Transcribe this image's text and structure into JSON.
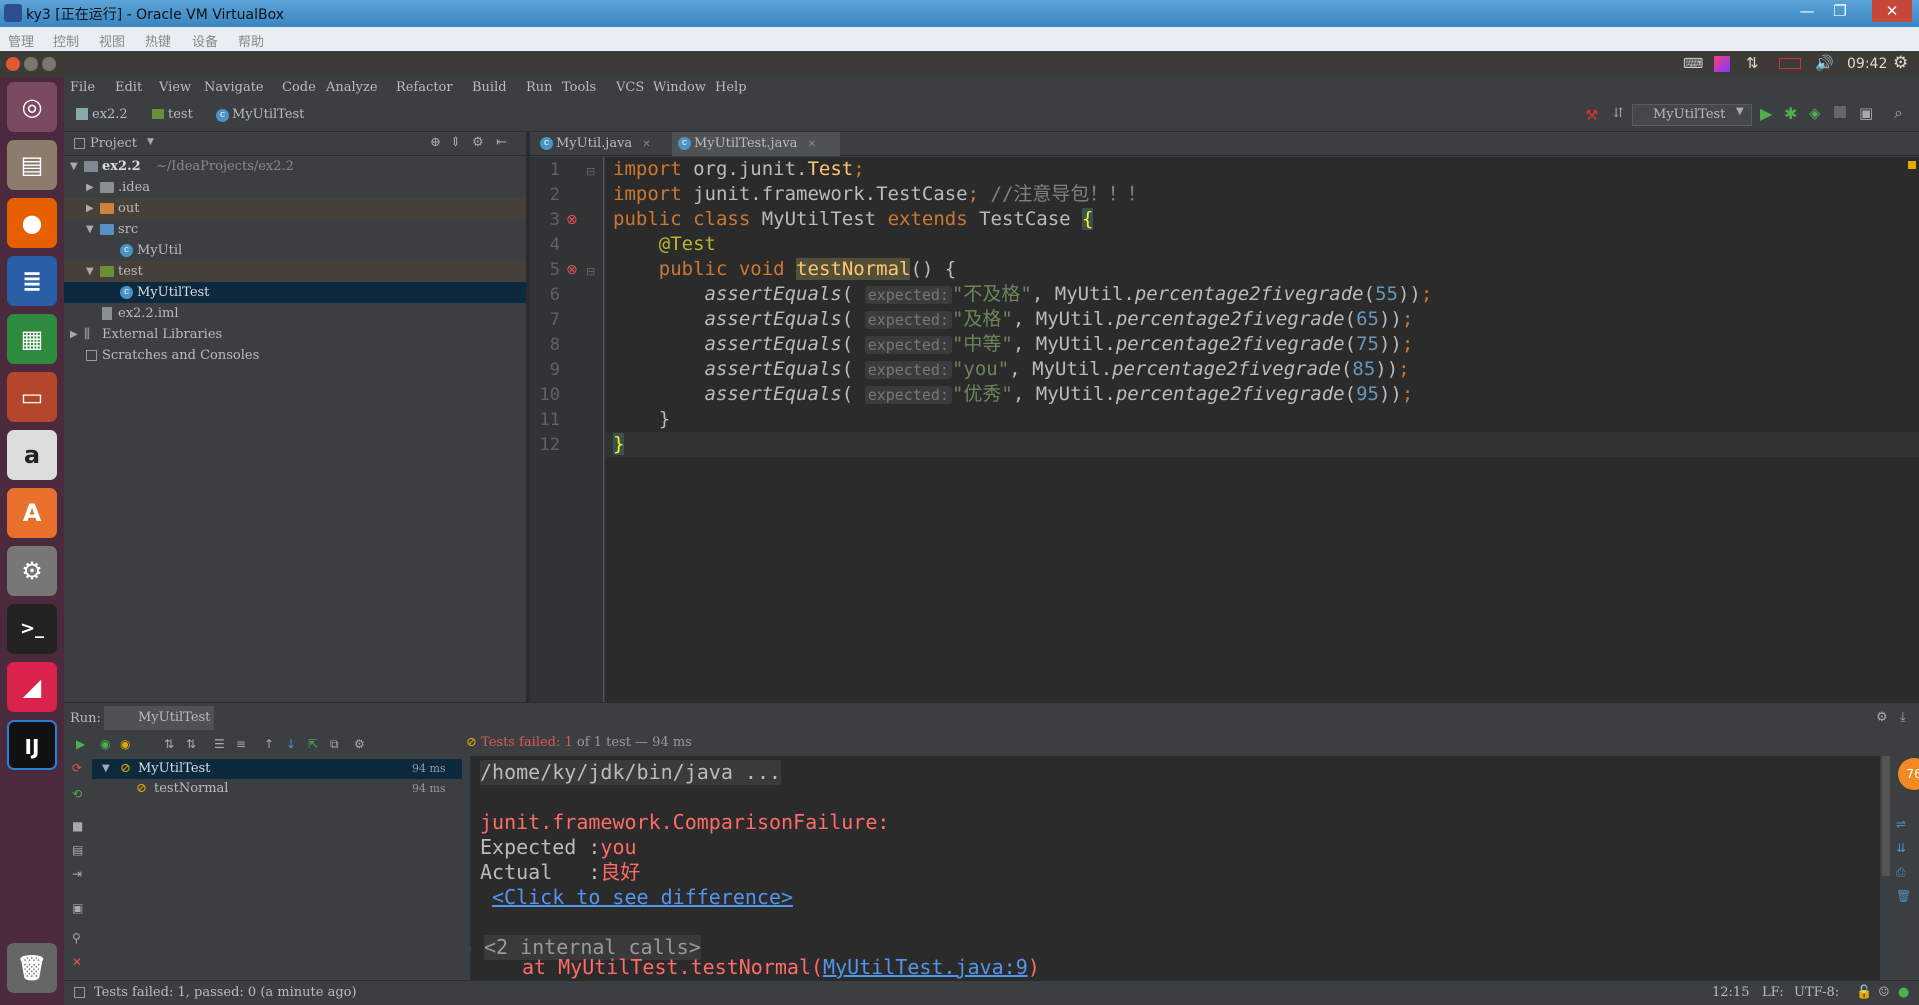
{
  "window": {
    "title": "ky3 [正在运行] - Oracle VM VirtualBox",
    "minimize": "—",
    "restore": "❐",
    "close": "✕"
  },
  "vbox_menu": [
    "管理",
    "控制",
    "视图",
    "热键",
    "设备",
    "帮助"
  ],
  "top_panel": {
    "clock": "09:42"
  },
  "ide_menu": [
    "File",
    "Edit",
    "View",
    "Navigate",
    "Code",
    "Analyze",
    "Refactor",
    "Build",
    "Run",
    "Tools",
    "VCS",
    "Window",
    "Help"
  ],
  "breadcrumb": [
    "ex2.2",
    "test",
    "MyUtilTest"
  ],
  "run_config": "MyUtilTest",
  "project_panel": {
    "title": "Project",
    "tree": [
      {
        "label": "ex2.2",
        "path": "~/IdeaProjects/ex2.2"
      },
      {
        "label": ".idea"
      },
      {
        "label": "out"
      },
      {
        "label": "src"
      },
      {
        "label": "MyUtil"
      },
      {
        "label": "test"
      },
      {
        "label": "MyUtilTest"
      },
      {
        "label": "ex2.2.iml"
      },
      {
        "label": "External Libraries"
      },
      {
        "label": "Scratches and Consoles"
      }
    ]
  },
  "editor_tabs": [
    "MyUtil.java",
    "MyUtilTest.java"
  ],
  "line_numbers": [
    "1",
    "2",
    "3",
    "4",
    "5",
    "6",
    "7",
    "8",
    "9",
    "10",
    "11",
    "12"
  ],
  "code": {
    "l1": {
      "kw": "import",
      "pkg": " org.junit.",
      "cls": "Test",
      "semi": ";"
    },
    "l2": {
      "kw": "import",
      "pkg": " junit.framework.",
      "cls": "TestCase",
      "semi": "; ",
      "comment": "//注意导包！！！"
    },
    "l3": {
      "kw": "public class",
      "name": " MyUtilTest ",
      "ext": "extends",
      "base": " TestCase ",
      "brace": "{"
    },
    "l4": {
      "ann": "@Test"
    },
    "l5": {
      "kw": "public void",
      "method": "testNormal",
      "rest": "() {"
    },
    "asserts": [
      {
        "fn": "assertEquals",
        "hint": "expected:",
        "str": "\"不及格\"",
        "call": "MyUtil.",
        "m": "percentage2fivegrade",
        "arg": "55"
      },
      {
        "fn": "assertEquals",
        "hint": "expected:",
        "str": "\"及格\"",
        "call": "MyUtil.",
        "m": "percentage2fivegrade",
        "arg": "65"
      },
      {
        "fn": "assertEquals",
        "hint": "expected:",
        "str": "\"中等\"",
        "call": "MyUtil.",
        "m": "percentage2fivegrade",
        "arg": "75"
      },
      {
        "fn": "assertEquals",
        "hint": "expected:",
        "str": "\"you\"",
        "call": "MyUtil.",
        "m": "percentage2fivegrade",
        "arg": "85"
      },
      {
        "fn": "assertEquals",
        "hint": "expected:",
        "str": "\"优秀\"",
        "call": "MyUtil.",
        "m": "percentage2fivegrade",
        "arg": "95"
      }
    ],
    "l11": "}",
    "l12": "}"
  },
  "run_panel": {
    "label": "Run:",
    "tab": "MyUtilTest",
    "summary_prefix": "Tests failed: ",
    "summary_count": "1",
    "summary_suffix": " of 1 test — 94 ms",
    "tree": [
      {
        "label": "MyUtilTest",
        "time": "94 ms"
      },
      {
        "label": "testNormal",
        "time": "94 ms"
      }
    ],
    "console": {
      "cmd": "/home/ky/jdk/bin/java ...",
      "exception": "junit.framework.ComparisonFailure:",
      "expected_label": "Expected :",
      "expected_val": "you",
      "actual_label": "Actual   :",
      "actual_val": "良好",
      "diff_link": "<Click to see difference>",
      "internal": "<2 internal calls>",
      "at_prefix": "at MyUtilTest.testNormal(",
      "at_link": "MyUtilTest.java:9",
      "at_suffix": ")"
    }
  },
  "status_bar": {
    "message": "Tests failed: 1, passed: 0 (a minute ago)",
    "position": "12:15",
    "line_sep": "LF:",
    "encoding": "UTF-8:"
  },
  "badge": "76"
}
